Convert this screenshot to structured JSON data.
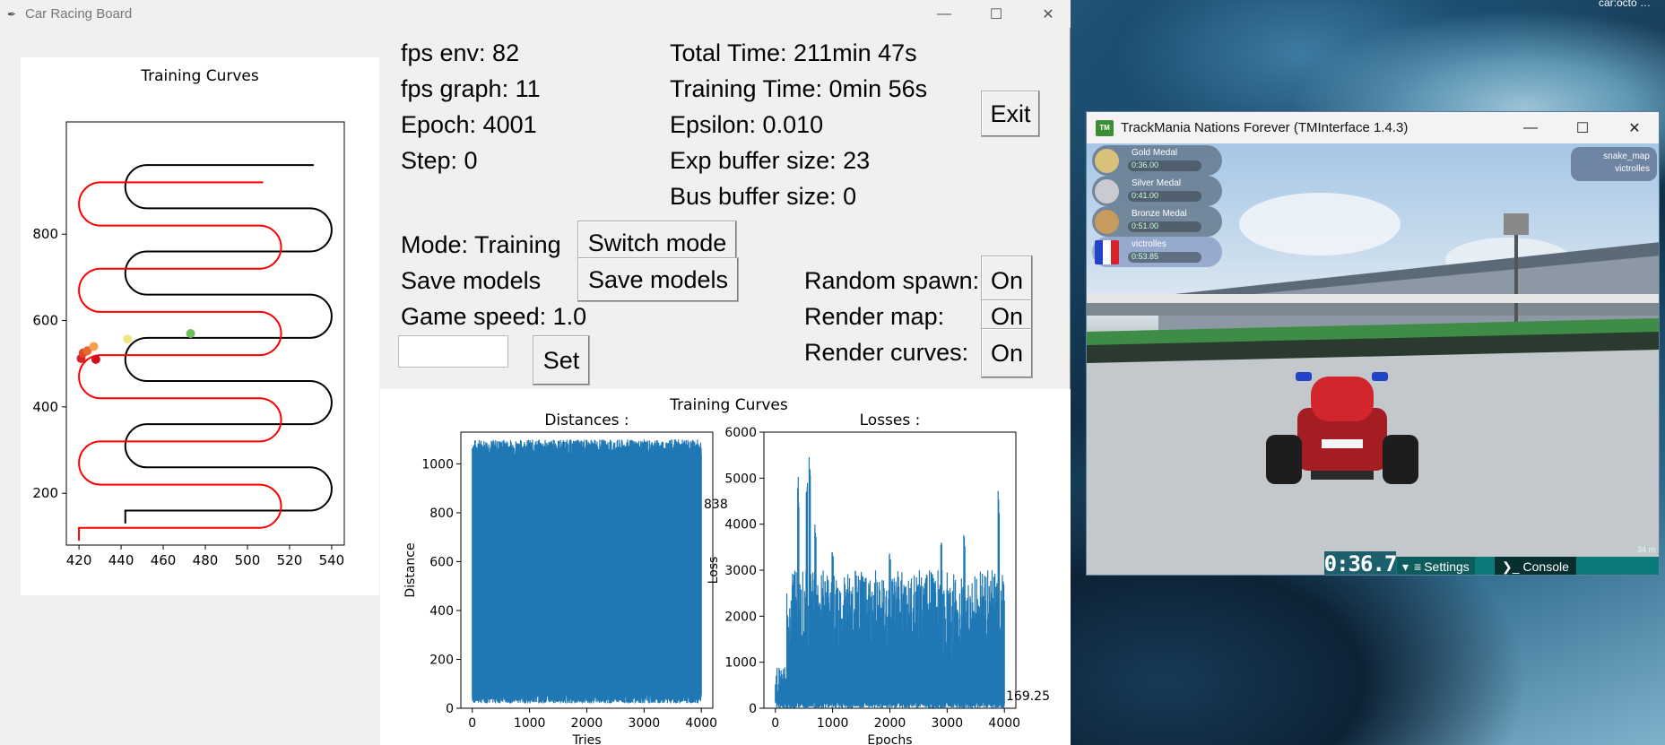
{
  "window": {
    "title": "Car Racing Board"
  },
  "desktop": {
    "corner_text": "car:octo …"
  },
  "stats": {
    "fps_env": "fps env: 82",
    "fps_graph": "fps graph: 11",
    "epoch": "Epoch: 4001",
    "step": "Step: 0",
    "total_time": "Total Time: 211min 47s",
    "training_time": "Training Time: 0min 56s",
    "epsilon": "Epsilon: 0.010",
    "exp_buffer": "Exp buffer size: 23",
    "bus_buffer": "Bus buffer size: 0"
  },
  "controls": {
    "exit_label": "Exit",
    "mode_label": "Mode: Training",
    "switch_mode_label": "Switch mode",
    "save_models_text": "Save models",
    "save_models_button": "Save models",
    "game_speed_label": "Game speed: 1.0",
    "game_speed_value": "",
    "set_label": "Set",
    "random_spawn_label": "Random spawn:",
    "random_spawn_value": "On",
    "render_map_label": "Render map:",
    "render_map_value": "On",
    "render_curves_label": "Render curves:",
    "render_curves_value": "On"
  },
  "map_chart": {
    "title": "Training Curves",
    "x_ticks": [
      "420",
      "440",
      "460",
      "480",
      "500",
      "520",
      "540"
    ],
    "y_ticks": [
      "200",
      "400",
      "600",
      "800"
    ],
    "xlim": [
      414,
      546
    ],
    "ylim": [
      80,
      1060
    ],
    "car_points": [
      {
        "x": 421,
        "y": 512,
        "color": "#d62728"
      },
      {
        "x": 422,
        "y": 525,
        "color": "#e0492b"
      },
      {
        "x": 424,
        "y": 530,
        "color": "#e86a2e"
      },
      {
        "x": 428,
        "y": 510,
        "color": "#d10f1f"
      },
      {
        "x": 427,
        "y": 540,
        "color": "#f5a14a"
      },
      {
        "x": 443,
        "y": 557,
        "color": "#f3e38a"
      },
      {
        "x": 473,
        "y": 570,
        "color": "#6dbf5a"
      }
    ],
    "colors": {
      "track_red": "#ff0000",
      "track_black": "#000000"
    }
  },
  "curves": {
    "title": "Training Curves",
    "distances": {
      "title": "Distances :",
      "xlabel": "Tries",
      "ylabel": "Distance",
      "x_ticks": [
        "0",
        "1000",
        "2000",
        "3000",
        "4000"
      ],
      "y_ticks": [
        "0",
        "200",
        "400",
        "600",
        "800",
        "1000"
      ],
      "xlim": [
        -200,
        4200
      ],
      "ylim": [
        0,
        1130
      ],
      "annotation": "838",
      "color": "#1f77b4"
    },
    "losses": {
      "title": "Losses :",
      "xlabel": "Epochs",
      "ylabel": "Loss",
      "x_ticks": [
        "0",
        "1000",
        "2000",
        "3000",
        "4000"
      ],
      "y_ticks": [
        "0",
        "1000",
        "2000",
        "3000",
        "4000",
        "5000",
        "6000"
      ],
      "xlim": [
        -200,
        4200
      ],
      "ylim": [
        0,
        6000
      ],
      "annotation": "169.25",
      "color": "#1f77b4"
    }
  },
  "chart_data": [
    {
      "type": "line",
      "title": "Distances :",
      "xlabel": "Tries",
      "ylabel": "Distance",
      "xlim": [
        -200,
        4200
      ],
      "ylim": [
        0,
        1130
      ],
      "series": [
        {
          "values_range": [
            20,
            1100
          ],
          "x_range": [
            0,
            4000
          ]
        }
      ],
      "annotation": "838"
    },
    {
      "type": "line",
      "title": "Losses :",
      "xlabel": "Epochs",
      "ylabel": "Loss",
      "xlim": [
        -200,
        4200
      ],
      "ylim": [
        0,
        6000
      ],
      "series": [
        {
          "peaks": [
            [
              400,
              5100
            ],
            [
              550,
              5000
            ],
            [
              600,
              5750
            ],
            [
              700,
              4200
            ],
            [
              1000,
              3400
            ],
            [
              1500,
              3100
            ],
            [
              2000,
              3400
            ],
            [
              2900,
              3600
            ],
            [
              3300,
              3800
            ],
            [
              3900,
              4750
            ]
          ]
        }
      ],
      "annotation": "169.25"
    }
  ],
  "trackmania": {
    "title": "TrackMania Nations Forever (TMInterface 1.4.3)",
    "logo_text": "TM",
    "medals": [
      {
        "name": "Gold Medal",
        "time": "0:36.00",
        "color": "#d8c27a"
      },
      {
        "name": "Silver Medal",
        "time": "0:41.00",
        "color": "#c9cbd0"
      },
      {
        "name": "Bronze Medal",
        "time": "0:51.00",
        "color": "#c79b5e"
      },
      {
        "name": "victrolles",
        "time": "0:53.85",
        "color": "#3a5fcd"
      }
    ],
    "map_name": "snake_map",
    "player": "victrolles",
    "timer": "0:36.7",
    "settings_label": "Settings",
    "console_label": "Console",
    "distance": "34 m"
  }
}
